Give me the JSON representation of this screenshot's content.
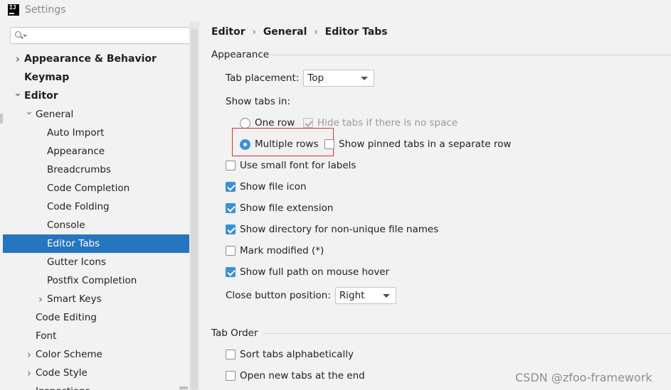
{
  "window": {
    "title": "Settings",
    "app_icon_text": "IJ"
  },
  "search": {
    "placeholder": "",
    "value": ""
  },
  "tree": [
    {
      "label": "Appearance & Behavior",
      "level": 0,
      "bold": true,
      "chevron": "right"
    },
    {
      "label": "Keymap",
      "level": 0,
      "bold": true,
      "chevron": ""
    },
    {
      "label": "Editor",
      "level": 0,
      "bold": true,
      "chevron": "down"
    },
    {
      "label": "General",
      "level": 1,
      "bold": false,
      "chevron": "down"
    },
    {
      "label": "Auto Import",
      "level": 2,
      "bold": false,
      "chevron": ""
    },
    {
      "label": "Appearance",
      "level": 2,
      "bold": false,
      "chevron": ""
    },
    {
      "label": "Breadcrumbs",
      "level": 2,
      "bold": false,
      "chevron": ""
    },
    {
      "label": "Code Completion",
      "level": 2,
      "bold": false,
      "chevron": ""
    },
    {
      "label": "Code Folding",
      "level": 2,
      "bold": false,
      "chevron": ""
    },
    {
      "label": "Console",
      "level": 2,
      "bold": false,
      "chevron": ""
    },
    {
      "label": "Editor Tabs",
      "level": 2,
      "bold": false,
      "chevron": "",
      "selected": true
    },
    {
      "label": "Gutter Icons",
      "level": 2,
      "bold": false,
      "chevron": ""
    },
    {
      "label": "Postfix Completion",
      "level": 2,
      "bold": false,
      "chevron": ""
    },
    {
      "label": "Smart Keys",
      "level": 2,
      "bold": false,
      "chevron": "right"
    },
    {
      "label": "Code Editing",
      "level": 1,
      "bold": false,
      "chevron": ""
    },
    {
      "label": "Font",
      "level": 1,
      "bold": false,
      "chevron": ""
    },
    {
      "label": "Color Scheme",
      "level": 1,
      "bold": false,
      "chevron": "right"
    },
    {
      "label": "Code Style",
      "level": 1,
      "bold": false,
      "chevron": "right"
    },
    {
      "label": "Inspections",
      "level": 1,
      "bold": false,
      "chevron": ""
    }
  ],
  "breadcrumb": {
    "items": [
      "Editor",
      "General",
      "Editor Tabs"
    ],
    "separator": "›"
  },
  "appearance": {
    "title": "Appearance",
    "tab_placement_label": "Tab placement:",
    "tab_placement_value": "Top",
    "show_tabs_in_label": "Show tabs in:",
    "one_row_label": "One row",
    "hide_tabs_label": "Hide tabs if there is no space",
    "multiple_rows_label": "Multiple rows",
    "show_pinned_label": "Show pinned tabs in a separate row",
    "small_font_label": "Use small font for labels",
    "show_file_icon_label": "Show file icon",
    "show_file_extension_label": "Show file extension",
    "show_directory_label": "Show directory for non-unique file names",
    "mark_modified_label": "Mark modified (*)",
    "show_full_path_label": "Show full path on mouse hover",
    "close_button_label": "Close button position:",
    "close_button_value": "Right"
  },
  "tab_order": {
    "title": "Tab Order",
    "sort_alpha_label": "Sort tabs alphabetically",
    "open_end_label": "Open new tabs at the end"
  },
  "watermark": "CSDN @zfoo-framework",
  "colors": {
    "selection": "#2675bf",
    "accent": "#3d8fd9",
    "highlight": "#e02a2a"
  }
}
